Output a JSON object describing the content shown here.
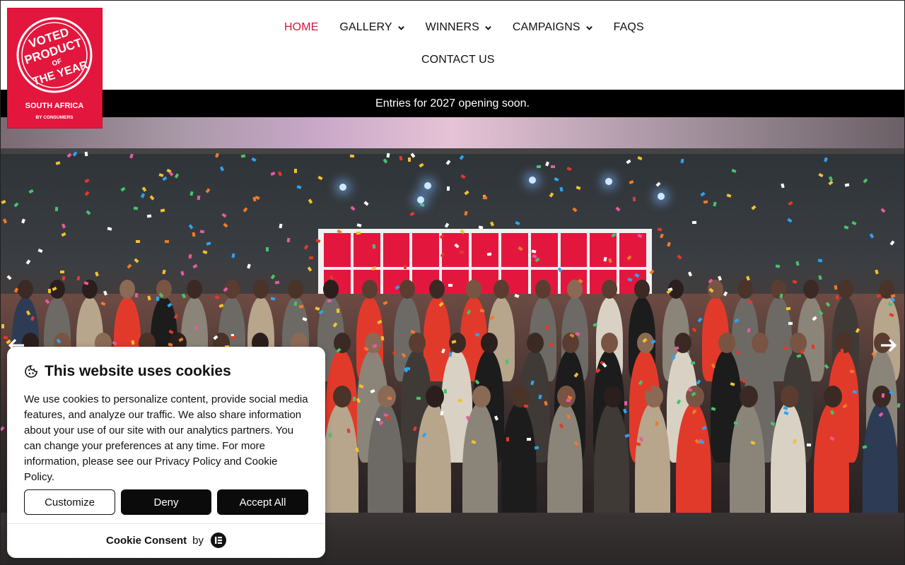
{
  "brand": {
    "logo_lines": [
      "VOTED",
      "PRODUCT",
      "OF",
      "THE YEAR"
    ],
    "logo_region": "SOUTH AFRICA",
    "logo_tagline": "BY CONSUMERS",
    "accent_color": "#e3173e"
  },
  "nav": {
    "items": [
      {
        "label": "HOME",
        "active": true,
        "has_dropdown": false
      },
      {
        "label": "GALLERY",
        "active": false,
        "has_dropdown": true
      },
      {
        "label": "WINNERS",
        "active": false,
        "has_dropdown": true
      },
      {
        "label": "CAMPAIGNS",
        "active": false,
        "has_dropdown": true
      },
      {
        "label": "FAQS",
        "active": false,
        "has_dropdown": false
      },
      {
        "label": "CONTACT US",
        "active": false,
        "has_dropdown": false
      }
    ]
  },
  "announcement": {
    "text": "Entries for 2027 opening soon."
  },
  "hero": {
    "prev_icon": "arrow-left-icon",
    "next_icon": "arrow-right-icon"
  },
  "cookie": {
    "title": "This website uses cookies",
    "body": "We use cookies to personalize content, provide social media features, and analyze our traffic. We also share information about your use of our site with our analytics partners. You can change your preferences at any time. For more information, please see our Privacy Policy and Cookie Policy.",
    "customize_label": "Customize",
    "deny_label": "Deny",
    "accept_label": "Accept All",
    "footer_brand": "Cookie Consent",
    "footer_by": "by"
  }
}
